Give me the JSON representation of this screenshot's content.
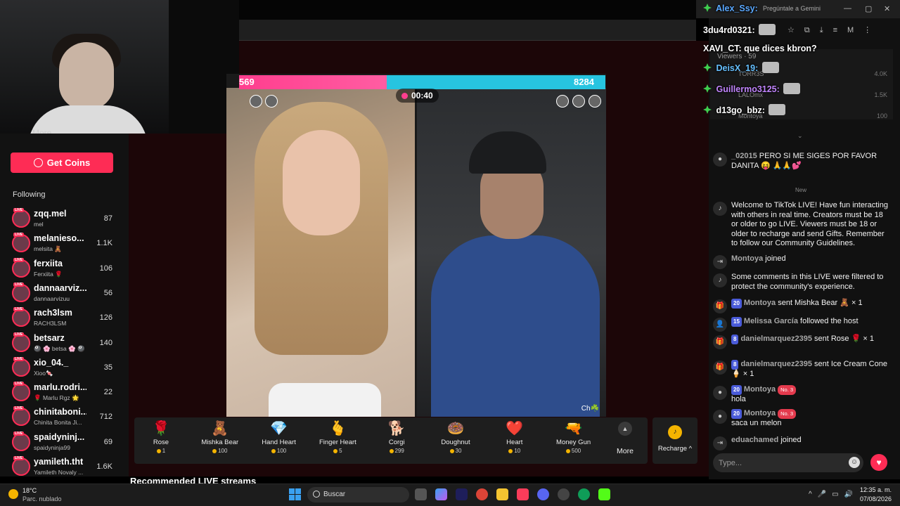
{
  "sidebar": {
    "more_label": "More",
    "get_coins": "Get Coins",
    "following_title": "Following",
    "items": [
      {
        "name": "zqq.mel",
        "sub": "mel",
        "count": "87"
      },
      {
        "name": "melanieso...",
        "sub": "melsita 🧸",
        "count": "1.1K"
      },
      {
        "name": "ferxiita",
        "sub": "Ferxiita 🌹",
        "count": "106"
      },
      {
        "name": "dannaarviz...",
        "sub": "dannaarvizuu",
        "count": "56"
      },
      {
        "name": "rach3lsm",
        "sub": "RACH3LSM",
        "count": "126"
      },
      {
        "name": "betsarz",
        "sub": "🎱 🌸 betsa 🌸 🎱",
        "count": "140"
      },
      {
        "name": "xio_04._",
        "sub": "Xioo🍬",
        "count": "35"
      },
      {
        "name": "marlu.rodri...",
        "sub": "🌹 Marlu Rgz 🌟",
        "count": "22"
      },
      {
        "name": "chinitaboni...",
        "sub": "Chinita Bonita Ji...",
        "count": "712"
      },
      {
        "name": "spaidyninj...",
        "sub": "spaidyninja99",
        "count": "69"
      },
      {
        "name": "yamileth.tht",
        "sub": "Yamileth Novaly ...",
        "count": "1.6K"
      }
    ]
  },
  "battle": {
    "score_left": "569",
    "score_right": "8284",
    "score_left_fraction": 0.064,
    "timer": "00:40",
    "right_tag": "Ch☘️"
  },
  "gifts": [
    {
      "icon": "🌹",
      "name": "Rose",
      "price": "1"
    },
    {
      "icon": "🧸",
      "name": "Mishka Bear",
      "price": "100"
    },
    {
      "icon": "💎",
      "name": "Hand Heart",
      "price": "100"
    },
    {
      "icon": "🫰",
      "name": "Finger Heart",
      "price": "5"
    },
    {
      "icon": "🐕",
      "name": "Corgi",
      "price": "299"
    },
    {
      "icon": "🍩",
      "name": "Doughnut",
      "price": "30"
    },
    {
      "icon": "❤️",
      "name": "Heart",
      "price": "10"
    },
    {
      "icon": "🔫",
      "name": "Money Gun",
      "price": "500"
    }
  ],
  "gifts_more": "More",
  "recharge": "Recharge ^",
  "recommended": "Recommended LIVE streams",
  "browser": {
    "gemini_hint": "Pregúntale a Gemini"
  },
  "viewers": {
    "title": "Viewers · 59",
    "rows": [
      {
        "name": "TORR3S",
        "value": "4.0K"
      },
      {
        "name": "LALOmx",
        "value": "1.5K"
      },
      {
        "name": "Montoya",
        "value": "100"
      }
    ]
  },
  "overlay_chat": [
    {
      "user": "Alex_Ssy:",
      "text": "",
      "color": "#5aa8ff",
      "badge": true,
      "emote": false
    },
    {
      "user": "3du4rd0321:",
      "text": "",
      "color": "#ffffff",
      "badge": false,
      "emote": true
    },
    {
      "user": "XAVI_CT:",
      "text": " que dices kbron?",
      "color": "#ffffff",
      "badge": false,
      "emote": false
    },
    {
      "user": "DeisX_19:",
      "text": "",
      "color": "#66c0ff",
      "badge": true,
      "emote": true
    },
    {
      "user": "Guillermo3125:",
      "text": "",
      "color": "#c084fc",
      "badge": true,
      "emote": true
    },
    {
      "user": "d13go_bbz:",
      "text": "",
      "color": "#ffffff",
      "badge": true,
      "emote": true
    }
  ],
  "chat": {
    "new_label": "New",
    "messages": [
      {
        "icon": "●",
        "user": "_02015",
        "text": "PERO SI ME SIGES POR FAVOR DANITA 😝 🙏🙏💕",
        "lvl": "",
        "rank": ""
      },
      {
        "icon": "♪",
        "user": "",
        "text": "Welcome to TikTok LIVE! Have fun interacting with others in real time. Creators must be 18 or older to go LIVE. Viewers must be 18 or older to recharge and send Gifts. Remember to follow our Community Guidelines.",
        "lvl": "",
        "rank": ""
      },
      {
        "icon": "⇥",
        "user": "Montoya",
        "text": "joined",
        "lvl": "",
        "rank": ""
      },
      {
        "icon": "♪",
        "user": "",
        "text": "Some comments in this LIVE were filtered to protect the community's experience.",
        "lvl": "",
        "rank": ""
      },
      {
        "icon": "🎁",
        "user": "Montoya",
        "text": "sent Mishka Bear 🧸 × 1",
        "lvl": "20",
        "rank": ""
      },
      {
        "icon": "👤",
        "user": "Melissa García",
        "text": "followed the host",
        "lvl": "15",
        "rank": ""
      },
      {
        "icon": "🎁",
        "user": "danielmarquez2395",
        "text": "sent Rose 🌹 × 1",
        "lvl": "8",
        "rank": ""
      },
      {
        "icon": "🎁",
        "user": "danielmarquez2395",
        "text": "sent Ice Cream Cone 🍦 × 1",
        "lvl": "8",
        "rank": ""
      },
      {
        "icon": "●",
        "user": "Montoya",
        "text": "hola",
        "lvl": "20",
        "rank": "No. 3"
      },
      {
        "icon": "●",
        "user": "Montoya",
        "text": "saca un melon",
        "lvl": "20",
        "rank": "No. 3"
      },
      {
        "icon": "⇥",
        "user": "eduachamed",
        "text": "joined",
        "lvl": "",
        "rank": ""
      }
    ],
    "input_placeholder": "Type..."
  },
  "taskbar": {
    "weather_temp": "18°C",
    "weather_desc": "Parc. nublado",
    "search": "Buscar",
    "time": "12:35 a. m.",
    "date": "07/08/2026"
  }
}
